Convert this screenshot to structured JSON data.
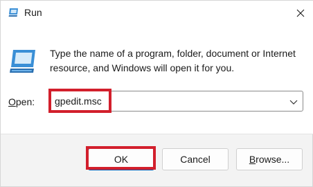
{
  "window": {
    "title": "Run",
    "title_icon": "run-icon",
    "close_icon": "close-icon"
  },
  "content": {
    "icon": "run-app-icon",
    "description": "Type the name of a program, folder, document or Internet resource, and Windows will open it for you.",
    "open_label_accel": "O",
    "open_label_rest": "pen:",
    "open_value": "gpedit.msc",
    "dropdown_icon": "chevron-down-icon"
  },
  "buttons": {
    "ok": "OK",
    "cancel": "Cancel",
    "browse_accel": "B",
    "browse_rest": "rowse..."
  },
  "colors": {
    "highlight": "#d21f2c",
    "icon_blue": "#3a8fd6",
    "ok_border": "#005fb8"
  }
}
